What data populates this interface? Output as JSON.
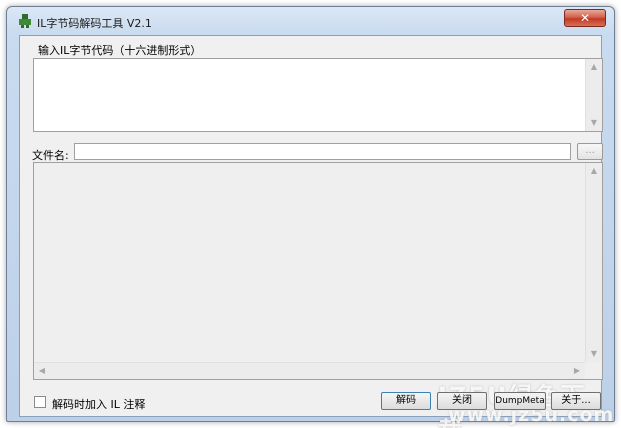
{
  "window": {
    "title": "IL字节码解码工具 V2.1",
    "close_label": "✕"
  },
  "input_section": {
    "label": "输入IL字节代码（十六进制形式）",
    "value": ""
  },
  "file": {
    "label": "文件名:",
    "value": "",
    "browse_label": "..."
  },
  "output": {
    "value": ""
  },
  "options": {
    "add_comment_label": "解码时加入 IL 注释",
    "add_comment_checked": false
  },
  "buttons": {
    "decode": "解码",
    "close": "关闭",
    "dumpmeta": "DumpMeta",
    "about": "关于..."
  },
  "watermark": {
    "main": "JZ5U绿色下载",
    "url": "www.jz5u.com"
  }
}
